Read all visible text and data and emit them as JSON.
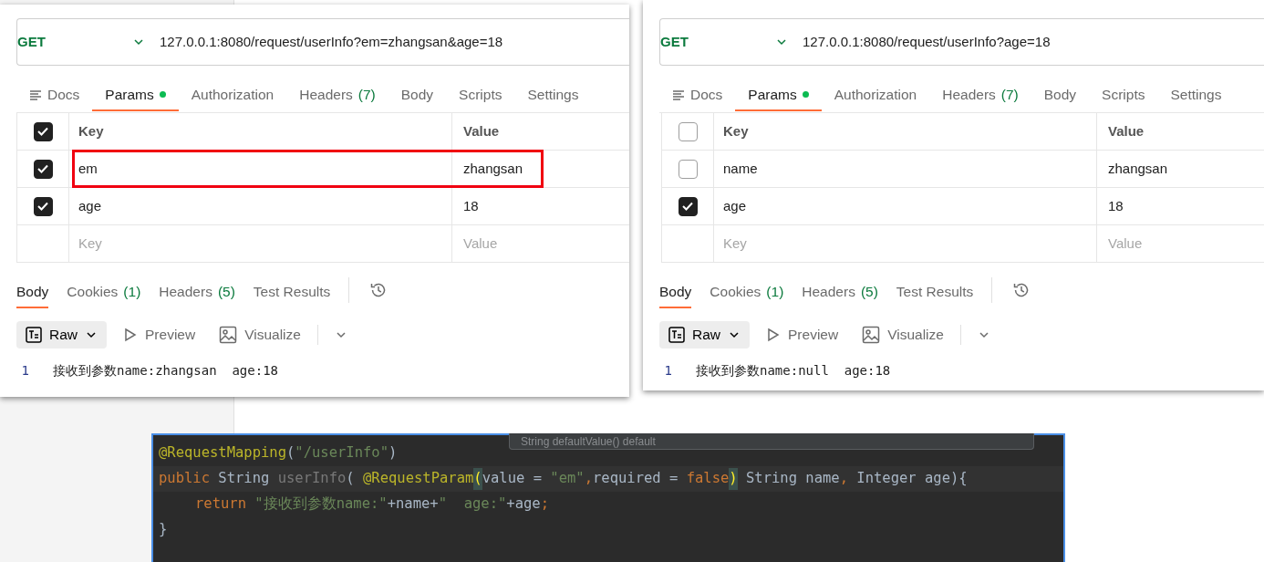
{
  "windows": [
    {
      "method": "GET",
      "url": "127.0.0.1:8080/request/userInfo?em=zhangsan&age=18",
      "request_tabs": [
        {
          "label": "Docs",
          "kind": "docs",
          "selected": false
        },
        {
          "label": "Params",
          "selected": true,
          "modified": true
        },
        {
          "label": "Authorization",
          "selected": false
        },
        {
          "label": "Headers",
          "count": "(7)",
          "selected": false
        },
        {
          "label": "Body",
          "selected": false
        },
        {
          "label": "Scripts",
          "selected": false
        },
        {
          "label": "Settings",
          "selected": false
        }
      ],
      "params": {
        "columns": [
          "Key",
          "Value"
        ],
        "all_checked": true,
        "rows": [
          {
            "key": "em",
            "value": "zhangsan",
            "checked": true,
            "highlighted": true
          },
          {
            "key": "age",
            "value": "18",
            "checked": true,
            "highlighted": false
          }
        ],
        "key_placeholder": "Key",
        "value_placeholder": "Value"
      },
      "response_tabs": [
        {
          "label": "Body",
          "selected": true
        },
        {
          "label": "Cookies",
          "count": "(1)",
          "selected": false
        },
        {
          "label": "Headers",
          "count": "(5)",
          "selected": false
        },
        {
          "label": "Test Results",
          "selected": false
        }
      ],
      "format": "Raw",
      "views": [
        {
          "label": "Preview",
          "kind": "preview"
        },
        {
          "label": "Visualize",
          "kind": "visualize"
        }
      ],
      "lines": [
        {
          "number": "1",
          "text": "接收到参数name:zhangsan  age:18"
        }
      ]
    },
    {
      "method": "GET",
      "url": "127.0.0.1:8080/request/userInfo?age=18",
      "request_tabs": [
        {
          "label": "Docs",
          "kind": "docs",
          "selected": false
        },
        {
          "label": "Params",
          "selected": true,
          "modified": true
        },
        {
          "label": "Authorization",
          "selected": false
        },
        {
          "label": "Headers",
          "count": "(7)",
          "selected": false
        },
        {
          "label": "Body",
          "selected": false
        },
        {
          "label": "Scripts",
          "selected": false
        },
        {
          "label": "Settings",
          "selected": false
        }
      ],
      "params": {
        "columns": [
          "Key",
          "Value"
        ],
        "all_checked": false,
        "rows": [
          {
            "key": "name",
            "value": "zhangsan",
            "checked": false,
            "highlighted": false
          },
          {
            "key": "age",
            "value": "18",
            "checked": true,
            "highlighted": false
          }
        ],
        "key_placeholder": "Key",
        "value_placeholder": "Value"
      },
      "response_tabs": [
        {
          "label": "Body",
          "selected": true
        },
        {
          "label": "Cookies",
          "count": "(1)",
          "selected": false
        },
        {
          "label": "Headers",
          "count": "(5)",
          "selected": false
        },
        {
          "label": "Test Results",
          "selected": false
        }
      ],
      "format": "Raw",
      "views": [
        {
          "label": "Preview",
          "kind": "preview"
        },
        {
          "label": "Visualize",
          "kind": "visualize"
        }
      ],
      "lines": [
        {
          "number": "1",
          "text": "接收到参数name:null  age:18"
        }
      ]
    }
  ],
  "code_editor": {
    "tooltip": "String defaultValue() default",
    "lines": [
      {
        "current": false,
        "tokens": [
          {
            "kind": "annotation",
            "text": "@RequestMapping"
          },
          {
            "kind": "plain",
            "text": "("
          },
          {
            "kind": "string",
            "text": "\"/userInfo\""
          },
          {
            "kind": "plain",
            "text": ")"
          }
        ]
      },
      {
        "current": true,
        "tokens": [
          {
            "kind": "keyword",
            "text": "public "
          },
          {
            "kind": "plain",
            "text": "String "
          },
          {
            "kind": "unused",
            "text": "userInfo"
          },
          {
            "kind": "plain",
            "text": "( "
          },
          {
            "kind": "annotation",
            "text": "@RequestParam"
          },
          {
            "kind": "bracket",
            "text": "("
          },
          {
            "kind": "plain",
            "text": "value = "
          },
          {
            "kind": "string",
            "text": "\"em\""
          },
          {
            "kind": "keyword",
            "text": ","
          },
          {
            "kind": "plain",
            "text": "required = "
          },
          {
            "kind": "keyword",
            "text": "false"
          },
          {
            "kind": "bracket",
            "text": ")"
          },
          {
            "kind": "plain",
            "text": " String name"
          },
          {
            "kind": "keyword",
            "text": ", "
          },
          {
            "kind": "plain",
            "text": "Integer age){"
          }
        ]
      },
      {
        "current": false,
        "indent": true,
        "tokens": [
          {
            "kind": "keyword",
            "text": "return "
          },
          {
            "kind": "string",
            "text": "\"接收到参数name:\""
          },
          {
            "kind": "plain",
            "text": "+name+"
          },
          {
            "kind": "string",
            "text": "\"  age:\""
          },
          {
            "kind": "plain",
            "text": "+age"
          },
          {
            "kind": "keyword",
            "text": ";"
          }
        ]
      },
      {
        "current": false,
        "tokens": [
          {
            "kind": "plain",
            "text": "}"
          }
        ]
      }
    ]
  }
}
